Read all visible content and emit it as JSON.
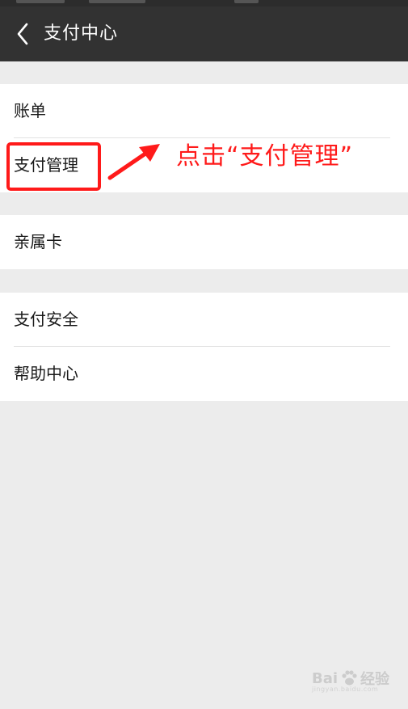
{
  "header": {
    "title": "支付中心",
    "back_icon": "chevron-left-icon"
  },
  "groups": [
    {
      "items": [
        {
          "label": "账单"
        },
        {
          "label": "支付管理"
        }
      ]
    },
    {
      "items": [
        {
          "label": "亲属卡"
        }
      ]
    },
    {
      "items": [
        {
          "label": "支付安全"
        },
        {
          "label": "帮助中心"
        }
      ]
    }
  ],
  "annotation": {
    "text": "点击“支付管理”",
    "color": "#ff1a1a"
  },
  "watermark": {
    "brand_left": "Bai",
    "brand_right": "经验",
    "url": "jingyan.baidu.com"
  },
  "colors": {
    "header_bg": "#323232",
    "page_bg": "#ececec",
    "annotation": "#ff1a1a"
  }
}
